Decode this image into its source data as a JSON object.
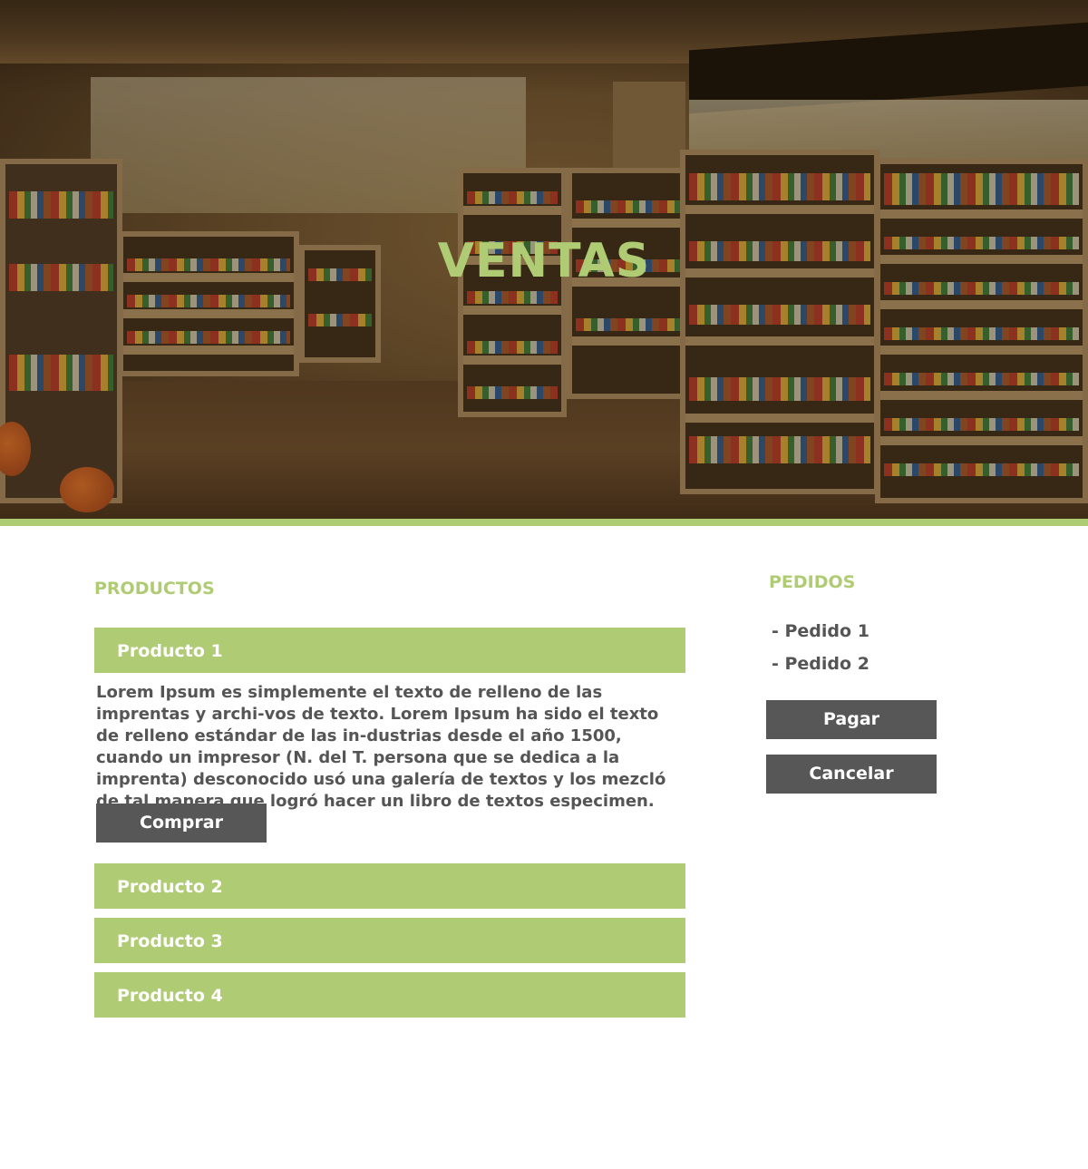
{
  "hero": {
    "title": "VENTAS"
  },
  "products": {
    "title": "PRODUCTOS",
    "items": [
      {
        "label": "Producto 1",
        "description": "Lorem Ipsum es simplemente el texto de relleno de las imprentas y archi-vos de texto. Lorem Ipsum ha sido el texto de relleno estándar de las in-dustrias desde el año 1500, cuando un impresor (N. del T. persona que se dedica a la imprenta) desconocido usó una galería de textos y los mezcló de tal manera que logró hacer un libro de textos especimen.",
        "buy_label": "Comprar",
        "expanded": true
      },
      {
        "label": "Producto 2",
        "expanded": false
      },
      {
        "label": "Producto 3",
        "expanded": false
      },
      {
        "label": "Producto 4",
        "expanded": false
      }
    ]
  },
  "orders": {
    "title": "PEDIDOS",
    "items": [
      "- Pedido 1",
      "- Pedido 2"
    ],
    "pay_label": "Pagar",
    "cancel_label": "Cancelar"
  },
  "colors": {
    "accent": "#afcb73",
    "button": "#575757",
    "text": "#555555"
  }
}
